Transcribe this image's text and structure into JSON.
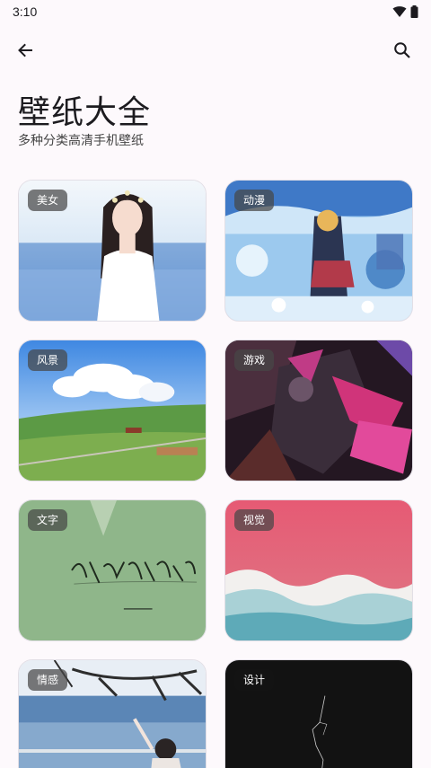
{
  "status_bar": {
    "time": "3:10",
    "wifi_icon": "wifi-icon",
    "battery_icon": "battery-icon"
  },
  "app_bar": {
    "back_icon": "arrow-back-icon",
    "search_icon": "search-icon"
  },
  "header": {
    "title": "壁纸大全",
    "subtitle": "多种分类高清手机壁纸"
  },
  "categories": [
    {
      "label": "美女"
    },
    {
      "label": "动漫"
    },
    {
      "label": "风景"
    },
    {
      "label": "游戏"
    },
    {
      "label": "文字"
    },
    {
      "label": "视觉"
    },
    {
      "label": "情感"
    },
    {
      "label": "设计"
    }
  ],
  "colors": {
    "background": "#fdf9fc",
    "tag_bg": "#464646",
    "text": "#1c1b1f"
  }
}
